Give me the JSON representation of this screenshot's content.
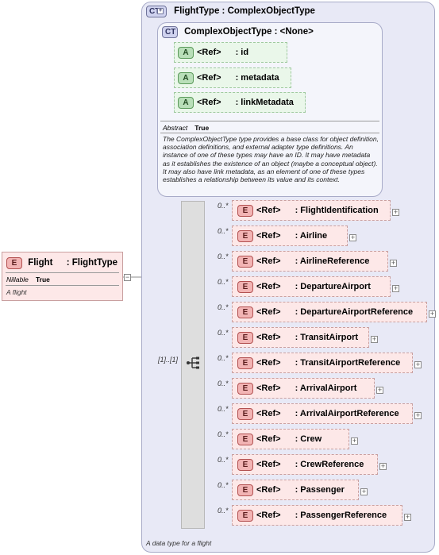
{
  "outer_type": {
    "badge": "CT",
    "title": "FlightType : ComplexObjectType",
    "footer": "A data type for a flight"
  },
  "base_type": {
    "badge": "CT",
    "title": "ComplexObjectType : <None>",
    "attributes": [
      {
        "badge": "A",
        "ref": "<Ref>",
        "name": ": id"
      },
      {
        "badge": "A",
        "ref": "<Ref>",
        "name": ": metadata"
      },
      {
        "badge": "A",
        "ref": "<Ref>",
        "name": ": linkMetadata"
      }
    ],
    "abstract_label": "Abstract",
    "abstract_value": "True",
    "description": "The ComplexObjectType type provides a base class for object definition, association definitions, and external adapter type definitions. An instance of one of these types may have an ID. It may have metadata as it establishes the existence of an object (maybe a conceptual object). It may also have link metadata, as an element of one of these types establishes a relationship between its value and its context."
  },
  "root_element": {
    "badge": "E",
    "name": "Flight",
    "type": ": FlightType",
    "nillable_label": "Nillable",
    "nillable_value": "True",
    "doc": "A flight"
  },
  "sequence": {
    "cardinality": "[1]..[1]"
  },
  "elements": [
    {
      "badge": "E",
      "card": "0..*",
      "ref": "<Ref>",
      "name": ": FlightIdentification"
    },
    {
      "badge": "E",
      "card": "0..*",
      "ref": "<Ref>",
      "name": ": Airline"
    },
    {
      "badge": "E",
      "card": "0..*",
      "ref": "<Ref>",
      "name": ": AirlineReference"
    },
    {
      "badge": "E",
      "card": "0..*",
      "ref": "<Ref>",
      "name": ": DepartureAirport"
    },
    {
      "badge": "E",
      "card": "0..*",
      "ref": "<Ref>",
      "name": ": DepartureAirportReference"
    },
    {
      "badge": "E",
      "card": "0..*",
      "ref": "<Ref>",
      "name": ": TransitAirport"
    },
    {
      "badge": "E",
      "card": "0..*",
      "ref": "<Ref>",
      "name": ": TransitAirportReference"
    },
    {
      "badge": "E",
      "card": "0..*",
      "ref": "<Ref>",
      "name": ": ArrivalAirport"
    },
    {
      "badge": "E",
      "card": "0..*",
      "ref": "<Ref>",
      "name": ": ArrivalAirportReference"
    },
    {
      "badge": "E",
      "card": "0..*",
      "ref": "<Ref>",
      "name": ": Crew"
    },
    {
      "badge": "E",
      "card": "0..*",
      "ref": "<Ref>",
      "name": ": CrewReference"
    },
    {
      "badge": "E",
      "card": "0..*",
      "ref": "<Ref>",
      "name": ": Passenger"
    },
    {
      "badge": "E",
      "card": "0..*",
      "ref": "<Ref>",
      "name": ": PassengerReference"
    }
  ]
}
